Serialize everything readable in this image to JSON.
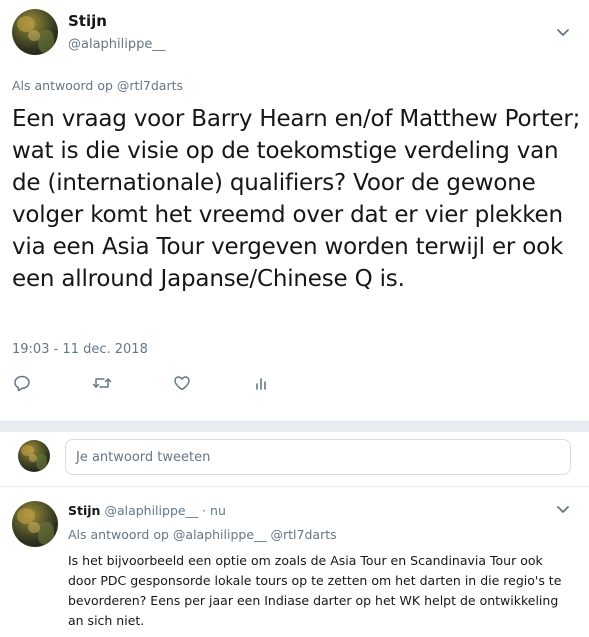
{
  "main_tweet": {
    "author_name": "Stijn",
    "author_handle": "@alaphilippe__",
    "reply_label": "Als antwoord op",
    "reply_mention": "@rtl7darts",
    "text": "Een vraag voor Barry Hearn en/of Matthew Porter; wat is die visie op de toekomstige verdeling van de (internationale) qualifiers? Voor de gewone volger komt het vreemd over dat er vier plekken via een Asia Tour vergeven worden terwijl er ook een allround Japanse/Chinese Q is.",
    "timestamp": "19:03 - 11 dec. 2018",
    "actions": [
      "reply-icon",
      "retweet-icon",
      "like-icon",
      "stats-icon"
    ]
  },
  "compose": {
    "placeholder": "Je antwoord tweeten"
  },
  "reply_tweet": {
    "author_name": "Stijn",
    "author_handle": "@alaphilippe__",
    "separator": "·",
    "time": "nu",
    "reply_label": "Als antwoord op",
    "reply_mentions": "@alaphilippe__ @rtl7darts",
    "text": "Is het bijvoorbeeld een optie om zoals de Asia Tour en Scandinavia Tour ook door PDC gesponsorde lokale tours op te zetten om het darten in die regio's te bevorderen? Eens per jaar een Indiase darter op het WK helpt de ontwikkeling an sich niet."
  },
  "colors": {
    "text_primary": "#14171a",
    "text_secondary": "#657786",
    "divider": "#e6ecf0",
    "background": "#ffffff"
  }
}
